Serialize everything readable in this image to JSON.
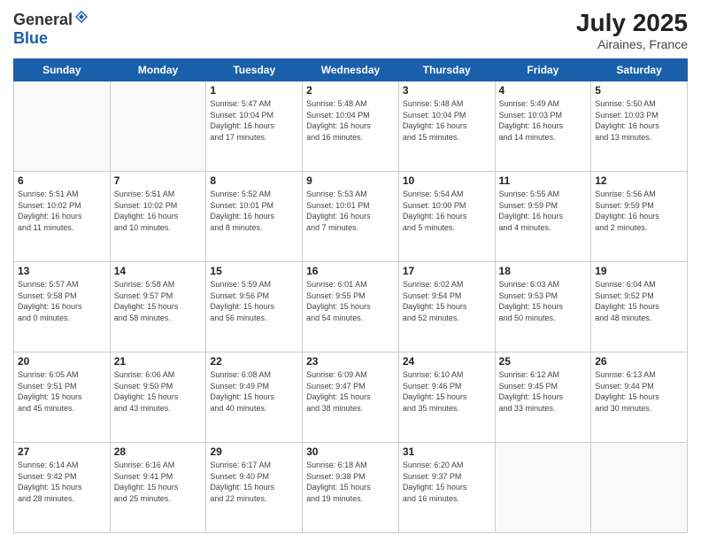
{
  "header": {
    "logo": {
      "general": "General",
      "blue": "Blue"
    },
    "title": "July 2025",
    "location": "Airaines, France"
  },
  "weekdays": [
    "Sunday",
    "Monday",
    "Tuesday",
    "Wednesday",
    "Thursday",
    "Friday",
    "Saturday"
  ],
  "weeks": [
    [
      {
        "day": "",
        "info": ""
      },
      {
        "day": "",
        "info": ""
      },
      {
        "day": "1",
        "info": "Sunrise: 5:47 AM\nSunset: 10:04 PM\nDaylight: 16 hours\nand 17 minutes."
      },
      {
        "day": "2",
        "info": "Sunrise: 5:48 AM\nSunset: 10:04 PM\nDaylight: 16 hours\nand 16 minutes."
      },
      {
        "day": "3",
        "info": "Sunrise: 5:48 AM\nSunset: 10:04 PM\nDaylight: 16 hours\nand 15 minutes."
      },
      {
        "day": "4",
        "info": "Sunrise: 5:49 AM\nSunset: 10:03 PM\nDaylight: 16 hours\nand 14 minutes."
      },
      {
        "day": "5",
        "info": "Sunrise: 5:50 AM\nSunset: 10:03 PM\nDaylight: 16 hours\nand 13 minutes."
      }
    ],
    [
      {
        "day": "6",
        "info": "Sunrise: 5:51 AM\nSunset: 10:02 PM\nDaylight: 16 hours\nand 11 minutes."
      },
      {
        "day": "7",
        "info": "Sunrise: 5:51 AM\nSunset: 10:02 PM\nDaylight: 16 hours\nand 10 minutes."
      },
      {
        "day": "8",
        "info": "Sunrise: 5:52 AM\nSunset: 10:01 PM\nDaylight: 16 hours\nand 8 minutes."
      },
      {
        "day": "9",
        "info": "Sunrise: 5:53 AM\nSunset: 10:01 PM\nDaylight: 16 hours\nand 7 minutes."
      },
      {
        "day": "10",
        "info": "Sunrise: 5:54 AM\nSunset: 10:00 PM\nDaylight: 16 hours\nand 5 minutes."
      },
      {
        "day": "11",
        "info": "Sunrise: 5:55 AM\nSunset: 9:59 PM\nDaylight: 16 hours\nand 4 minutes."
      },
      {
        "day": "12",
        "info": "Sunrise: 5:56 AM\nSunset: 9:59 PM\nDaylight: 16 hours\nand 2 minutes."
      }
    ],
    [
      {
        "day": "13",
        "info": "Sunrise: 5:57 AM\nSunset: 9:58 PM\nDaylight: 16 hours\nand 0 minutes."
      },
      {
        "day": "14",
        "info": "Sunrise: 5:58 AM\nSunset: 9:57 PM\nDaylight: 15 hours\nand 58 minutes."
      },
      {
        "day": "15",
        "info": "Sunrise: 5:59 AM\nSunset: 9:56 PM\nDaylight: 15 hours\nand 56 minutes."
      },
      {
        "day": "16",
        "info": "Sunrise: 6:01 AM\nSunset: 9:55 PM\nDaylight: 15 hours\nand 54 minutes."
      },
      {
        "day": "17",
        "info": "Sunrise: 6:02 AM\nSunset: 9:54 PM\nDaylight: 15 hours\nand 52 minutes."
      },
      {
        "day": "18",
        "info": "Sunrise: 6:03 AM\nSunset: 9:53 PM\nDaylight: 15 hours\nand 50 minutes."
      },
      {
        "day": "19",
        "info": "Sunrise: 6:04 AM\nSunset: 9:52 PM\nDaylight: 15 hours\nand 48 minutes."
      }
    ],
    [
      {
        "day": "20",
        "info": "Sunrise: 6:05 AM\nSunset: 9:51 PM\nDaylight: 15 hours\nand 45 minutes."
      },
      {
        "day": "21",
        "info": "Sunrise: 6:06 AM\nSunset: 9:50 PM\nDaylight: 15 hours\nand 43 minutes."
      },
      {
        "day": "22",
        "info": "Sunrise: 6:08 AM\nSunset: 9:49 PM\nDaylight: 15 hours\nand 40 minutes."
      },
      {
        "day": "23",
        "info": "Sunrise: 6:09 AM\nSunset: 9:47 PM\nDaylight: 15 hours\nand 38 minutes."
      },
      {
        "day": "24",
        "info": "Sunrise: 6:10 AM\nSunset: 9:46 PM\nDaylight: 15 hours\nand 35 minutes."
      },
      {
        "day": "25",
        "info": "Sunrise: 6:12 AM\nSunset: 9:45 PM\nDaylight: 15 hours\nand 33 minutes."
      },
      {
        "day": "26",
        "info": "Sunrise: 6:13 AM\nSunset: 9:44 PM\nDaylight: 15 hours\nand 30 minutes."
      }
    ],
    [
      {
        "day": "27",
        "info": "Sunrise: 6:14 AM\nSunset: 9:42 PM\nDaylight: 15 hours\nand 28 minutes."
      },
      {
        "day": "28",
        "info": "Sunrise: 6:16 AM\nSunset: 9:41 PM\nDaylight: 15 hours\nand 25 minutes."
      },
      {
        "day": "29",
        "info": "Sunrise: 6:17 AM\nSunset: 9:40 PM\nDaylight: 15 hours\nand 22 minutes."
      },
      {
        "day": "30",
        "info": "Sunrise: 6:18 AM\nSunset: 9:38 PM\nDaylight: 15 hours\nand 19 minutes."
      },
      {
        "day": "31",
        "info": "Sunrise: 6:20 AM\nSunset: 9:37 PM\nDaylight: 15 hours\nand 16 minutes."
      },
      {
        "day": "",
        "info": ""
      },
      {
        "day": "",
        "info": ""
      }
    ]
  ]
}
